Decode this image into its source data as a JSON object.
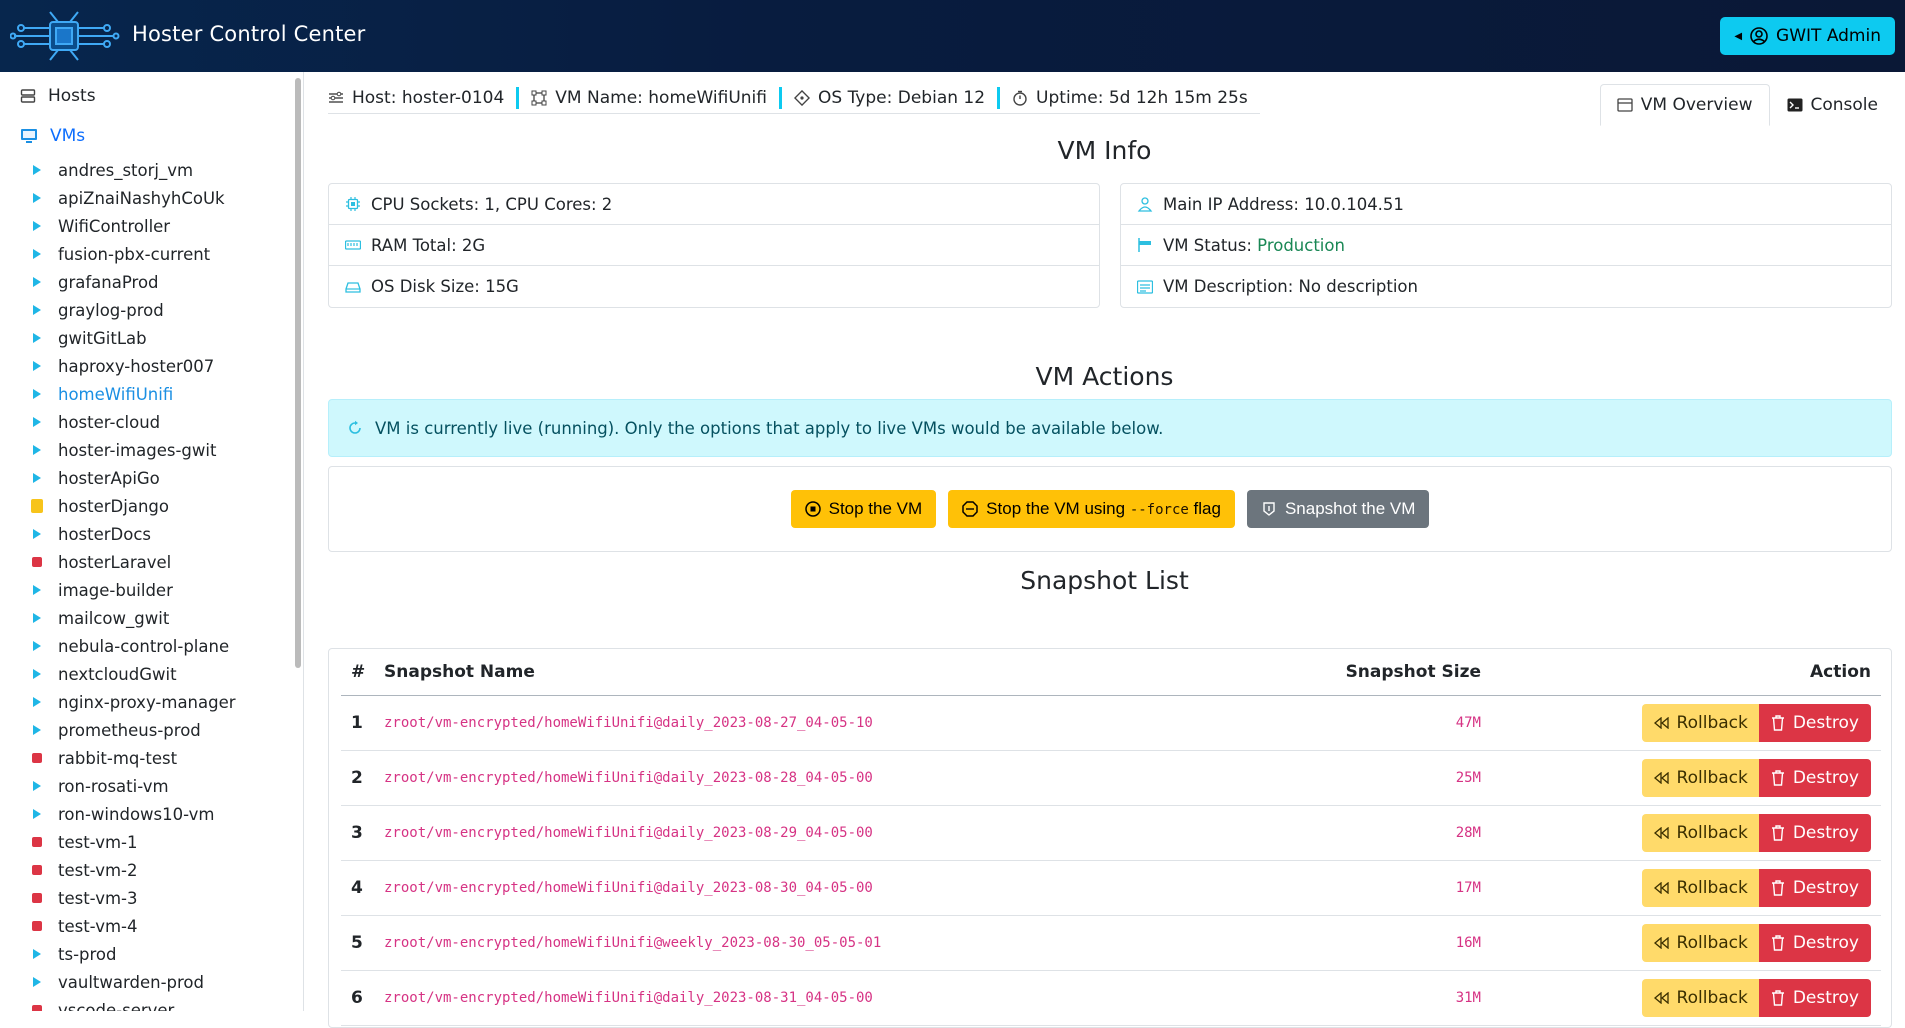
{
  "header": {
    "title": "Hoster Control Center",
    "admin_label": "GWIT Admin"
  },
  "sidebar": {
    "hosts_label": "Hosts",
    "vms_label": "VMs",
    "vms": [
      {
        "name": "andres_storj_vm",
        "state": "running"
      },
      {
        "name": "apiZnaiNashyhCoUk",
        "state": "running"
      },
      {
        "name": "WifiController",
        "state": "running"
      },
      {
        "name": "fusion-pbx-current",
        "state": "running"
      },
      {
        "name": "grafanaProd",
        "state": "running"
      },
      {
        "name": "graylog-prod",
        "state": "running"
      },
      {
        "name": "gwitGitLab",
        "state": "running"
      },
      {
        "name": "haproxy-hoster007",
        "state": "running"
      },
      {
        "name": "homeWifiUnifi",
        "state": "running",
        "active": true
      },
      {
        "name": "hoster-cloud",
        "state": "running"
      },
      {
        "name": "hoster-images-gwit",
        "state": "running"
      },
      {
        "name": "hosterApiGo",
        "state": "running"
      },
      {
        "name": "hosterDjango",
        "state": "backup"
      },
      {
        "name": "hosterDocs",
        "state": "running"
      },
      {
        "name": "hosterLaravel",
        "state": "stopped"
      },
      {
        "name": "image-builder",
        "state": "running"
      },
      {
        "name": "mailcow_gwit",
        "state": "running"
      },
      {
        "name": "nebula-control-plane",
        "state": "running"
      },
      {
        "name": "nextcloudGwit",
        "state": "running"
      },
      {
        "name": "nginx-proxy-manager",
        "state": "running"
      },
      {
        "name": "prometheus-prod",
        "state": "running"
      },
      {
        "name": "rabbit-mq-test",
        "state": "stopped"
      },
      {
        "name": "ron-rosati-vm",
        "state": "running"
      },
      {
        "name": "ron-windows10-vm",
        "state": "running"
      },
      {
        "name": "test-vm-1",
        "state": "stopped"
      },
      {
        "name": "test-vm-2",
        "state": "stopped"
      },
      {
        "name": "test-vm-3",
        "state": "stopped"
      },
      {
        "name": "test-vm-4",
        "state": "stopped"
      },
      {
        "name": "ts-prod",
        "state": "running"
      },
      {
        "name": "vaultwarden-prod",
        "state": "running"
      },
      {
        "name": "vscode-server",
        "state": "stopped"
      }
    ]
  },
  "infobar": {
    "host": "Host: hoster-0104",
    "vm_name": "VM Name: homeWifiUnifi",
    "os_type": "OS Type: Debian 12",
    "uptime": "Uptime: 5d 12h 15m 25s"
  },
  "tabs": {
    "overview": "VM Overview",
    "console": "Console"
  },
  "vm_info": {
    "title": "VM Info",
    "cpu": "CPU Sockets: 1, CPU Cores: 2",
    "ram": "RAM Total: 2G",
    "disk": "OS Disk Size: 15G",
    "ip": "Main IP Address: 10.0.104.51",
    "status_label": "VM Status: ",
    "status_value": "Production",
    "description": "VM Description: No description"
  },
  "vm_actions": {
    "title": "VM Actions",
    "alert": "VM is currently live (running). Only the options that apply to live VMs would be available below.",
    "stop": "Stop the VM",
    "stop_force_prefix": "Stop the VM using ",
    "stop_force_flag": "--force",
    "stop_force_suffix": " flag",
    "snapshot": "Snapshot the VM"
  },
  "snapshots": {
    "title": "Snapshot List",
    "columns": {
      "num": "#",
      "name": "Snapshot Name",
      "size": "Snapshot Size",
      "action": "Action"
    },
    "rollback_label": "Rollback",
    "destroy_label": "Destroy",
    "rows": [
      {
        "num": "1",
        "name": "zroot/vm-encrypted/homeWifiUnifi@daily_2023-08-27_04-05-10",
        "size": "47M"
      },
      {
        "num": "2",
        "name": "zroot/vm-encrypted/homeWifiUnifi@daily_2023-08-28_04-05-00",
        "size": "25M"
      },
      {
        "num": "3",
        "name": "zroot/vm-encrypted/homeWifiUnifi@daily_2023-08-29_04-05-00",
        "size": "28M"
      },
      {
        "num": "4",
        "name": "zroot/vm-encrypted/homeWifiUnifi@daily_2023-08-30_04-05-00",
        "size": "17M"
      },
      {
        "num": "5",
        "name": "zroot/vm-encrypted/homeWifiUnifi@weekly_2023-08-30_05-05-01",
        "size": "16M"
      },
      {
        "num": "6",
        "name": "zroot/vm-encrypted/homeWifiUnifi@daily_2023-08-31_04-05-00",
        "size": "31M"
      }
    ]
  },
  "colors": {
    "header_bg": "#081c3f",
    "accent": "#0dcaf0",
    "warning": "#ffc107",
    "danger": "#dc3545",
    "success": "#198754"
  }
}
